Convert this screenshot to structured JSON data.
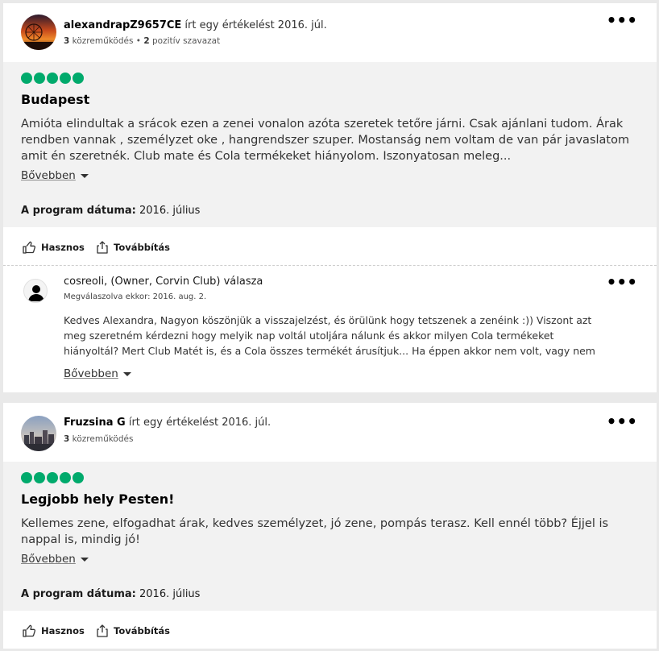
{
  "colors": {
    "rating": "#00aa6c",
    "body_bg": "#f2f2f2"
  },
  "reviews": [
    {
      "author": "alexandrapZ9657CE",
      "action": " írt egy értékelést 2016. júl.",
      "contrib_count": "3",
      "contrib_label": " közreműködés",
      "separator": " • ",
      "votes_count": "2",
      "votes_label": " pozitív szavazat",
      "menu_icon": "more-icon",
      "menu": "•••",
      "rating": 5,
      "title": "Budapest",
      "text": "Amióta elindultak a srácok ezen a zenei vonalon azóta szeretek tetőre járni. Csak ajánlani tudom. Árak rendben vannak , személyzet oke , hangrendszer szuper. Mostanság nem voltam de van pár javaslatom amit én szeretnék. Club mate és Cola termékeket hiányolom. Iszonyatosan meleg...",
      "more_label": "Bővebben",
      "date_label": "A program dátuma:",
      "date_value": " 2016. július",
      "helpful_label": "Hasznos",
      "share_label": "Továbbítás"
    },
    {
      "author": "Fruzsina G",
      "action": " írt egy értékelést 2016. júl.",
      "contrib_count": "3",
      "contrib_label": " közreműködés",
      "menu": "•••",
      "rating": 5,
      "title": "Legjobb hely Pesten!",
      "text": "Kellemes zene, elfogadhat árak, kedves személyzet, jó zene, pompás terasz. Kell ennél több? Éjjel is nappal is, mindig jó!",
      "more_label": "Bővebben",
      "date_label": "A program dátuma:",
      "date_value": " 2016. július",
      "helpful_label": "Hasznos",
      "share_label": "Továbbítás"
    }
  ],
  "reply": {
    "author": "cosreoli, (Owner, Corvin Club) válasza",
    "answered": "Megválaszolva ekkor: 2016. aug. 2.",
    "text": "Kedves Alexandra, Nagyon köszönjük a visszajelzést, és örülünk hogy tetszenek a zenéink :)) Viszont azt meg szeretném kérdezni hogy melyik nap voltál utoljára nálunk és akkor milyen Cola termékeket hiányoltál? Mert Club Matét is, és a Cola összes termékét árusítjuk... Ha éppen akkor nem volt, vagy nem",
    "more_label": "Bővebben",
    "menu": "•••"
  }
}
